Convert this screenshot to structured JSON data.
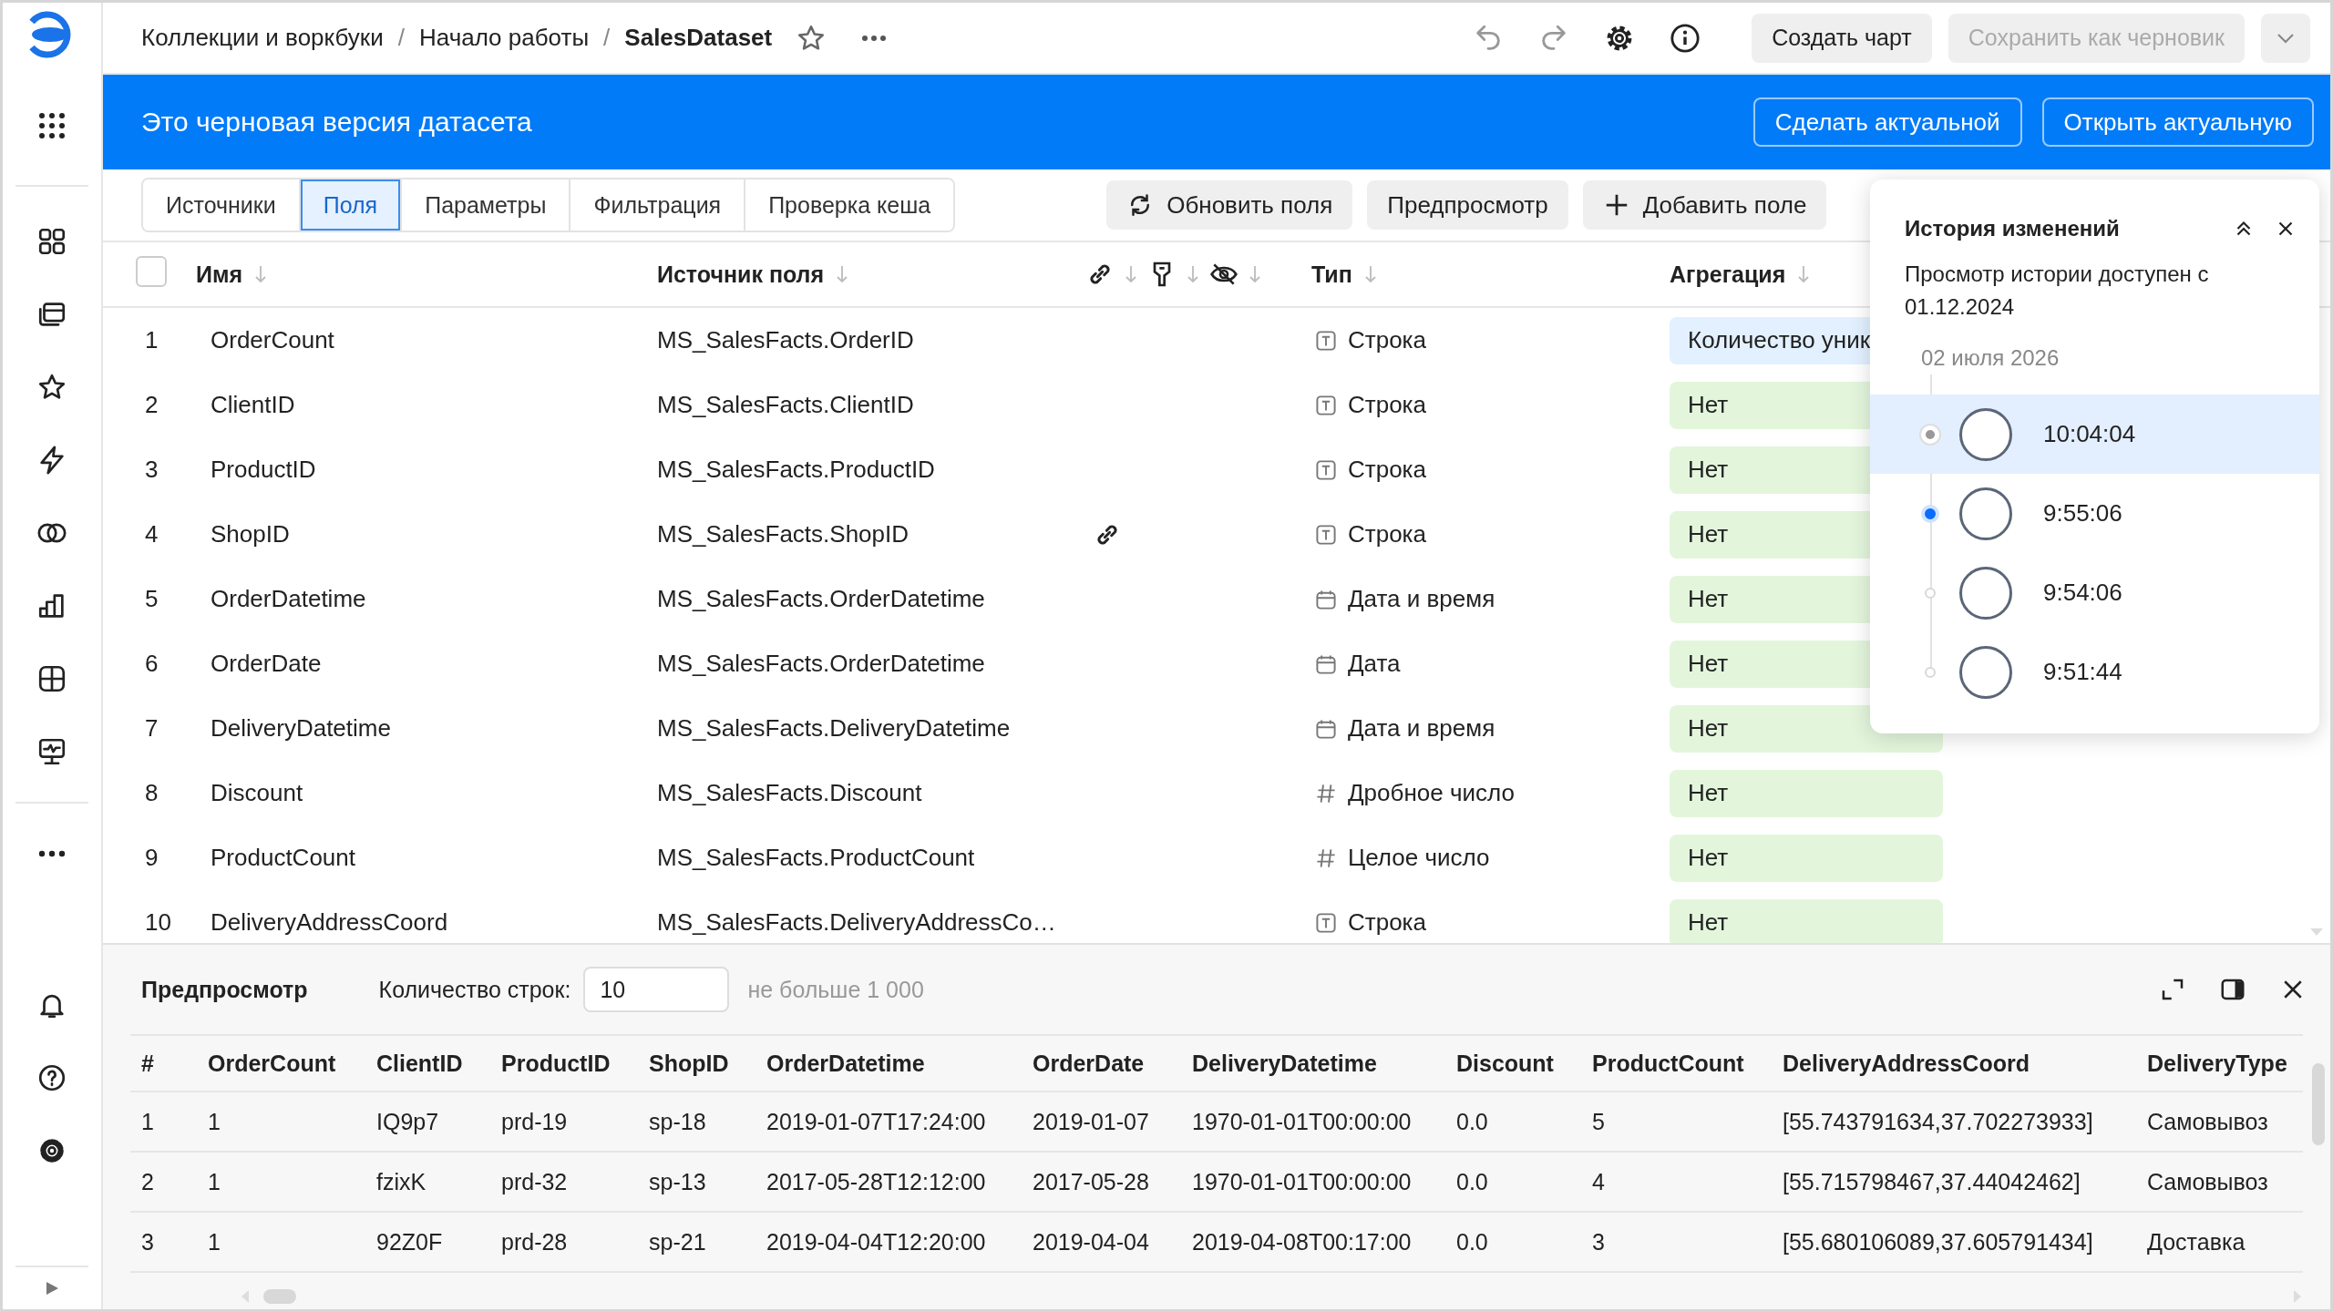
{
  "breadcrumbs": [
    {
      "label": "Коллекции и воркбуки",
      "current": false
    },
    {
      "separator": "/",
      "label": "Начало работы",
      "current": false
    },
    {
      "separator": "/",
      "label": "SalesDataset",
      "current": true
    }
  ],
  "top_actions": {
    "create_chart": {
      "label": "Создать чарт",
      "disabled": false
    },
    "save_draft": {
      "label": "Сохранить как черновик",
      "disabled": true
    }
  },
  "banner": {
    "text": "Это черновая версия датасета",
    "buttons": [
      "Сделать актуальной",
      "Открыть актуальную"
    ]
  },
  "tabs": [
    {
      "label": "Источники",
      "selected": false
    },
    {
      "label": "Поля",
      "selected": true
    },
    {
      "label": "Параметры",
      "selected": false
    },
    {
      "label": "Фильтрация",
      "selected": false
    },
    {
      "label": "Проверка кеша",
      "selected": false
    }
  ],
  "toolbar": [
    {
      "kind": "refresh",
      "label": "Обновить поля"
    },
    {
      "kind": "plain",
      "label": "Предпросмотр"
    },
    {
      "kind": "add",
      "label": "Добавить поле"
    }
  ],
  "fields": {
    "all_checked": false,
    "columns": {
      "name": "Имя",
      "source": "Источник поля",
      "type": "Тип",
      "aggregation": "Агрегация"
    },
    "rows": [
      {
        "index": "1",
        "name": "OrderCount",
        "source": "MS_SalesFacts.OrderID",
        "linked": false,
        "type": {
          "kind": "string",
          "label": "Строка"
        },
        "aggregation": {
          "label": "Количество уник",
          "aggregated": true
        }
      },
      {
        "index": "2",
        "name": "ClientID",
        "source": "MS_SalesFacts.ClientID",
        "linked": false,
        "type": {
          "kind": "string",
          "label": "Строка"
        },
        "aggregation": {
          "label": "Нет",
          "aggregated": false
        }
      },
      {
        "index": "3",
        "name": "ProductID",
        "source": "MS_SalesFacts.ProductID",
        "linked": false,
        "type": {
          "kind": "string",
          "label": "Строка"
        },
        "aggregation": {
          "label": "Нет",
          "aggregated": false
        }
      },
      {
        "index": "4",
        "name": "ShopID",
        "source": "MS_SalesFacts.ShopID",
        "linked": true,
        "type": {
          "kind": "string",
          "label": "Строка"
        },
        "aggregation": {
          "label": "Нет",
          "aggregated": false
        }
      },
      {
        "index": "5",
        "name": "OrderDatetime",
        "source": "MS_SalesFacts.OrderDatetime",
        "linked": false,
        "type": {
          "kind": "date",
          "label": "Дата и время"
        },
        "aggregation": {
          "label": "Нет",
          "aggregated": false
        }
      },
      {
        "index": "6",
        "name": "OrderDate",
        "source": "MS_SalesFacts.OrderDatetime",
        "linked": false,
        "type": {
          "kind": "date",
          "label": "Дата"
        },
        "aggregation": {
          "label": "Нет",
          "aggregated": false
        }
      },
      {
        "index": "7",
        "name": "DeliveryDatetime",
        "source": "MS_SalesFacts.DeliveryDatetime",
        "linked": false,
        "type": {
          "kind": "date",
          "label": "Дата и время"
        },
        "aggregation": {
          "label": "Нет",
          "aggregated": false
        }
      },
      {
        "index": "8",
        "name": "Discount",
        "source": "MS_SalesFacts.Discount",
        "linked": false,
        "type": {
          "kind": "number",
          "label": "Дробное число"
        },
        "aggregation": {
          "label": "Нет",
          "aggregated": false
        }
      },
      {
        "index": "9",
        "name": "ProductCount",
        "source": "MS_SalesFacts.ProductCount",
        "linked": false,
        "type": {
          "kind": "number",
          "label": "Целое число"
        },
        "aggregation": {
          "label": "Нет",
          "aggregated": false
        }
      },
      {
        "index": "10",
        "name": "DeliveryAddressCoord",
        "source": "MS_SalesFacts.DeliveryAddressCo…",
        "linked": false,
        "type": {
          "kind": "string",
          "label": "Строка"
        },
        "aggregation": {
          "label": "Нет",
          "aggregated": false
        }
      }
    ]
  },
  "history": {
    "title": "История изменений",
    "note": "Просмотр истории доступен с 01.12.2024",
    "date": "02 июля 2026",
    "entries": [
      {
        "time": "10:04:04",
        "selected": true,
        "current": false
      },
      {
        "time": "9:55:06",
        "selected": false,
        "current": true
      },
      {
        "time": "9:54:06",
        "selected": false,
        "current": false
      },
      {
        "time": "9:51:44",
        "selected": false,
        "current": false
      }
    ]
  },
  "preview": {
    "title": "Предпросмотр",
    "rows_label": "Количество строк:",
    "rows_count": "10",
    "hint": "не больше 1 000",
    "columns": [
      "#",
      "OrderCount",
      "ClientID",
      "ProductID",
      "ShopID",
      "OrderDatetime",
      "OrderDate",
      "DeliveryDatetime",
      "Discount",
      "ProductCount",
      "DeliveryAddressCoord",
      "DeliveryType"
    ],
    "rows": [
      [
        "1",
        "1",
        "IQ9p7",
        "prd-19",
        "sp-18",
        "2019-01-07T17:24:00",
        "2019-01-07",
        "1970-01-01T00:00:00",
        "0.0",
        "5",
        "[55.743791634,37.702273933]",
        "Самовывоз"
      ],
      [
        "2",
        "1",
        "fzixK",
        "prd-32",
        "sp-13",
        "2017-05-28T12:12:00",
        "2017-05-28",
        "1970-01-01T00:00:00",
        "0.0",
        "4",
        "[55.715798467,37.44042462]",
        "Самовывоз"
      ],
      [
        "3",
        "1",
        "92Z0F",
        "prd-28",
        "sp-21",
        "2019-04-04T12:20:00",
        "2019-04-04",
        "2019-04-08T00:17:00",
        "0.0",
        "3",
        "[55.680106089,37.605791434]",
        "Доставка"
      ]
    ]
  }
}
